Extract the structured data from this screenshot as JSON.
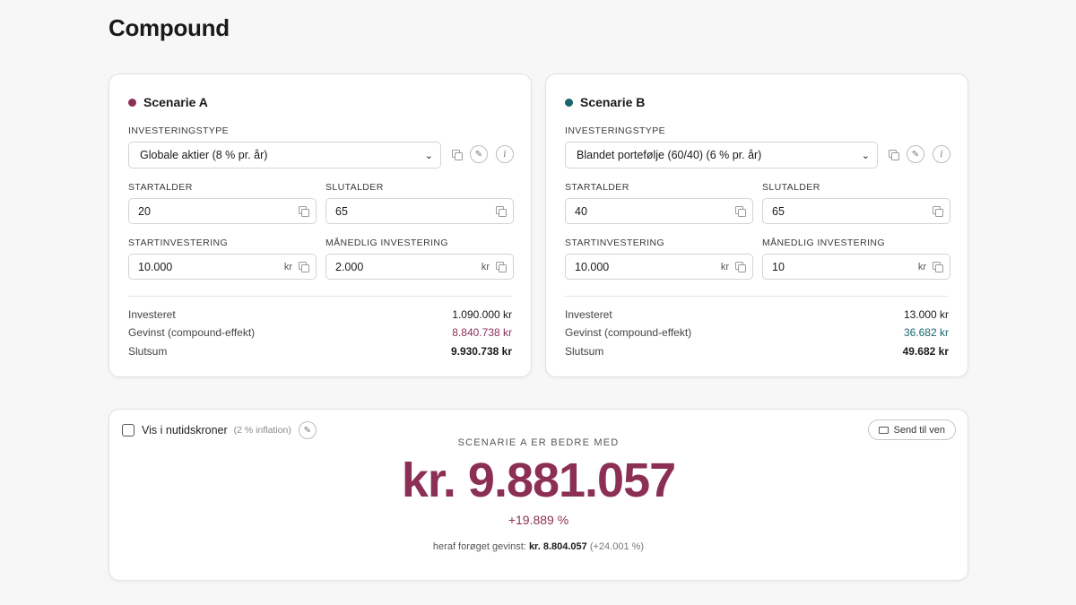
{
  "page": {
    "title": "Compound"
  },
  "colors": {
    "scenario_a": "#8c2f55",
    "scenario_b": "#17666f",
    "accent": "#8c2f55"
  },
  "labels": {
    "investment_type": "INVESTERINGSTYPE",
    "start_age": "STARTALDER",
    "end_age": "SLUTALDER",
    "start_investment": "STARTINVESTERING",
    "monthly_investment": "MÅNEDLIG INVESTERING",
    "invested": "Investeret",
    "gain": "Gevinst (compound-effekt)",
    "final_sum": "Slutsum",
    "currency_unit": "kr"
  },
  "scenario_a": {
    "title": "Scenarie A",
    "investment_type": "Globale aktier (8 % pr. år)",
    "start_age": "20",
    "end_age": "65",
    "start_investment": "10.000",
    "monthly_investment": "2.000",
    "invested": "1.090.000 kr",
    "gain": "8.840.738 kr",
    "final_sum": "9.930.738 kr"
  },
  "scenario_b": {
    "title": "Scenarie B",
    "investment_type": "Blandet portefølje (60/40) (6 % pr. år)",
    "start_age": "40",
    "end_age": "65",
    "start_investment": "10.000",
    "monthly_investment": "10",
    "invested": "13.000 kr",
    "gain": "36.682 kr",
    "final_sum": "49.682 kr"
  },
  "result": {
    "checkbox_label": "Vis i nutidskroner",
    "checkbox_checked": false,
    "inflation_note": "(2 % inflation)",
    "send_button": "Send til ven",
    "caption": "SCENARIE A ER BEDRE MED",
    "amount": "kr. 9.881.057",
    "percent": "+19.889 %",
    "sub_prefix": "heraf forøget gevinst:",
    "sub_amount": "kr. 8.804.057",
    "sub_percent": "(+24.001 %)"
  },
  "icons": {
    "copy": "copy-icon",
    "edit": "pencil-icon",
    "info": "info-icon",
    "dropdown": "chevron-down-icon",
    "mail": "mail-icon"
  }
}
